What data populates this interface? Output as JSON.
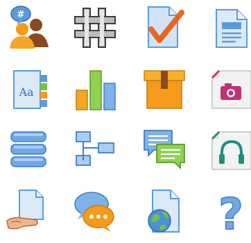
{
  "icons": [
    {
      "name": "users-chat-icon"
    },
    {
      "name": "hash-grid-icon"
    },
    {
      "name": "document-check-icon"
    },
    {
      "name": "document-text-icon"
    },
    {
      "name": "font-document-icon"
    },
    {
      "name": "bar-chart-icon"
    },
    {
      "name": "package-box-icon"
    },
    {
      "name": "image-file-icon"
    },
    {
      "name": "database-stack-icon"
    },
    {
      "name": "sitemap-icon"
    },
    {
      "name": "chat-bubbles-icon"
    },
    {
      "name": "audio-file-icon"
    },
    {
      "name": "hand-document-icon"
    },
    {
      "name": "speech-bubbles-dots-icon"
    },
    {
      "name": "globe-document-icon"
    },
    {
      "name": "help-question-icon"
    }
  ],
  "labels": {
    "font_sample": "Aa",
    "question_mark": "?"
  },
  "colors": {
    "blue_light": "#bcd8f5",
    "blue": "#5b9bd8",
    "orange": "#f59a1a",
    "green": "#74c043",
    "brown": "#8a4a1e",
    "gray": "#6d6d6d",
    "pink": "#c0317a",
    "teal": "#1f8e7d"
  }
}
